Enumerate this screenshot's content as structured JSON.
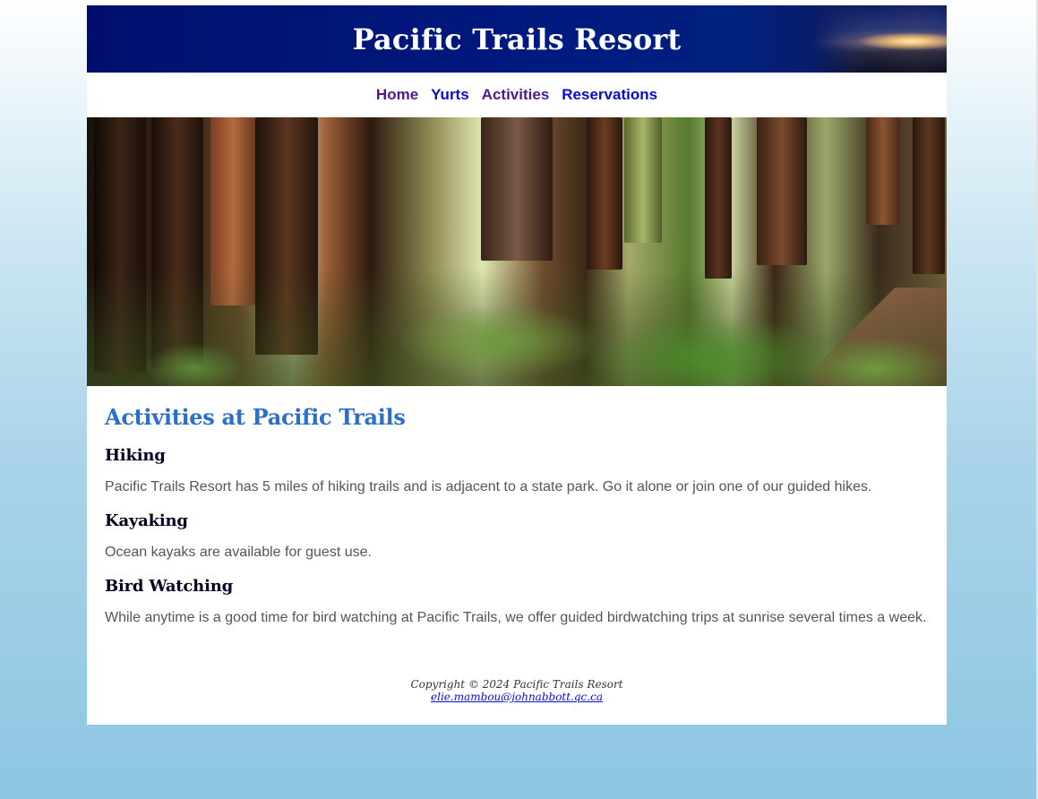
{
  "header": {
    "title": "Pacific Trails Resort"
  },
  "nav": {
    "items": [
      {
        "label": "Home",
        "state": "visited"
      },
      {
        "label": "Yurts",
        "state": "link"
      },
      {
        "label": "Activities",
        "state": "visited"
      },
      {
        "label": "Reservations",
        "state": "link"
      }
    ]
  },
  "hero": {
    "alt": "Redwood forest with ferns"
  },
  "main": {
    "heading": "Activities at Pacific Trails",
    "sections": [
      {
        "title": "Hiking",
        "text": "Pacific Trails Resort has 5 miles of hiking trails and is adjacent to a state park. Go it alone or join one of our guided hikes."
      },
      {
        "title": "Kayaking",
        "text": "Ocean kayaks are available for guest use."
      },
      {
        "title": "Bird Watching",
        "text": "While anytime is a good time for bird watching at Pacific Trails, we offer guided birdwatching trips at sunrise several times a week."
      }
    ]
  },
  "footer": {
    "copyright": "Copyright © 2024 Pacific Trails Resort",
    "email": "elie.mambou@johnabbott.qc.ca"
  },
  "colors": {
    "header_bg": "#001a80",
    "heading_blue": "#2a6fc9",
    "link_blue": "#0a0ad0",
    "visited_purple": "#52188c"
  }
}
